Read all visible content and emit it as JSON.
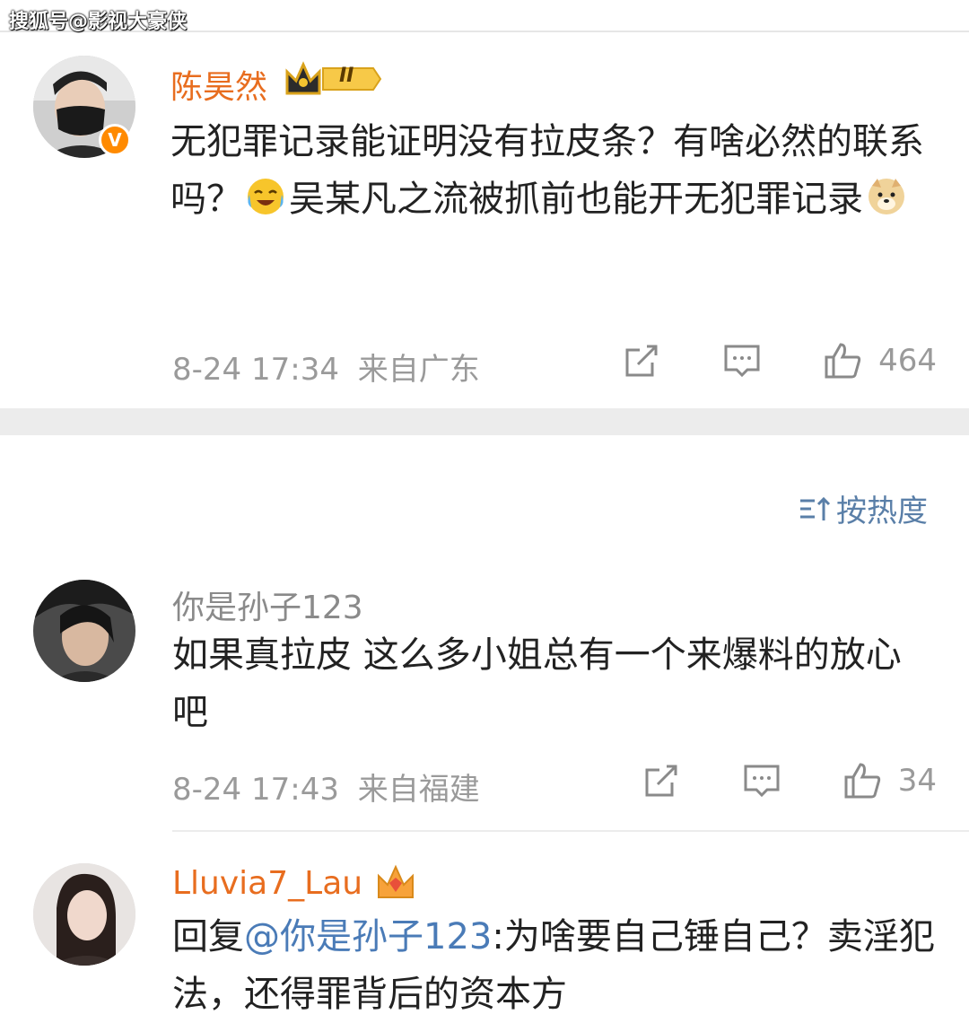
{
  "watermark": "搜狐号@影视大豪侠",
  "comments": [
    {
      "name": "陈昊然",
      "level_badge": "II",
      "text_part1": "无犯罪记录能证明没有拉皮条？有啥必然的联系吗？",
      "emoji1": "laugh-cry-emoji",
      "text_part2": "吴某凡之流被抓前也能开无犯罪记录",
      "emoji2": "doge-emoji",
      "time": "8-24 17:34",
      "location": "来自广东",
      "likes": "464"
    },
    {
      "name": "你是孙子123",
      "text": "如果真拉皮  这么多小姐总有一个来爆料的放心吧",
      "time": "8-24 17:43",
      "location": "来自福建",
      "likes": "34"
    },
    {
      "name": "Lluvia7_Lau",
      "reply_prefix": "回复",
      "mention": "@你是孙子123",
      "text": ":为啥要自己锤自己？卖淫犯法，还得罪背后的资本方"
    }
  ],
  "sort_label": "按热度",
  "colors": {
    "vip_name": "#e86d1f",
    "mention": "#4a7bb7",
    "sort": "#5a7fa8",
    "meta": "#9a9a9a"
  }
}
